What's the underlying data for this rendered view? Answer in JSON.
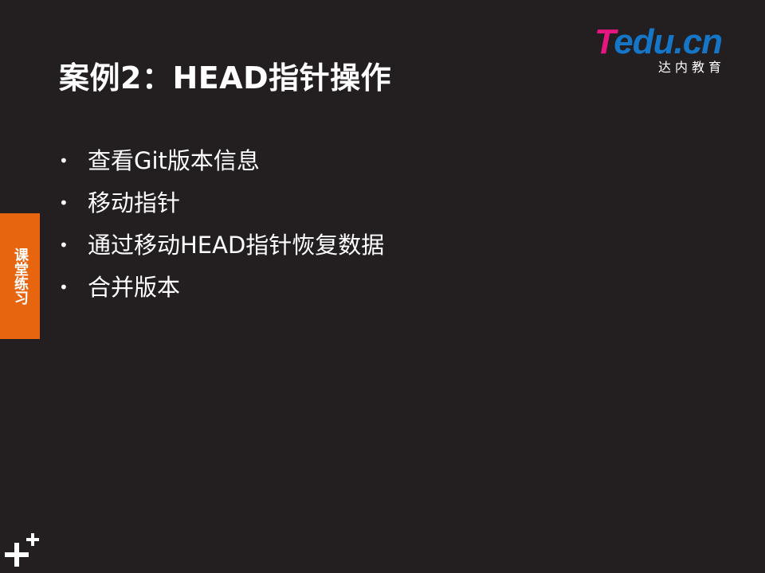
{
  "slide": {
    "title": "案例2：HEAD指针操作",
    "logo": {
      "brand_first": "T",
      "brand_rest": "edu.cn",
      "subtitle": "达内教育"
    },
    "bullets": [
      {
        "text": "查看Git版本信息"
      },
      {
        "text": "移动指针"
      },
      {
        "text": "通过移动HEAD指针恢复数据"
      },
      {
        "text": "合并版本"
      }
    ],
    "bullet_glyph": "•",
    "side_tab": {
      "label": "课堂练习",
      "color": "#e8650f"
    },
    "colors": {
      "background": "#231f20",
      "logo_pink": "#e6157f",
      "logo_blue": "#1576c8"
    },
    "icons": {
      "corner": "plus-cluster-icon"
    }
  }
}
